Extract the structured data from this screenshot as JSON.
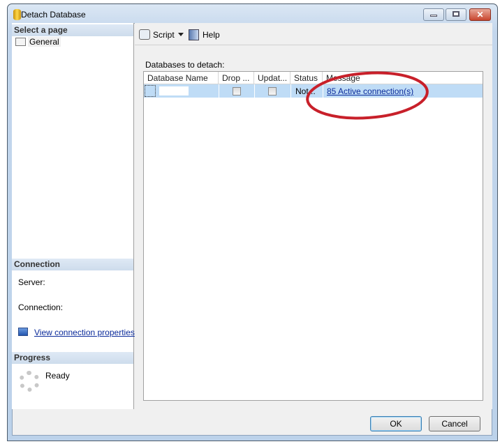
{
  "window": {
    "title": "Detach Database"
  },
  "left": {
    "select_header": "Select a page",
    "pages": [
      {
        "label": "General"
      }
    ],
    "connection_header": "Connection",
    "server_label": "Server:",
    "connection_label": "Connection:",
    "view_props_link": "View connection properties",
    "progress_header": "Progress",
    "progress_status": "Ready"
  },
  "toolbar": {
    "script": "Script",
    "help": "Help"
  },
  "main": {
    "grid_label": "Databases to detach:",
    "columns": [
      "Database Name",
      "Drop ...",
      "Updat...",
      "Status",
      "Message"
    ],
    "rows": [
      {
        "name": "",
        "drop": false,
        "update": false,
        "status": "Not...",
        "message": "85 Active connection(s)"
      }
    ]
  },
  "buttons": {
    "ok": "OK",
    "cancel": "Cancel"
  },
  "colors": {
    "annotation": "#c8202a",
    "selection": "#bfdcf6"
  }
}
